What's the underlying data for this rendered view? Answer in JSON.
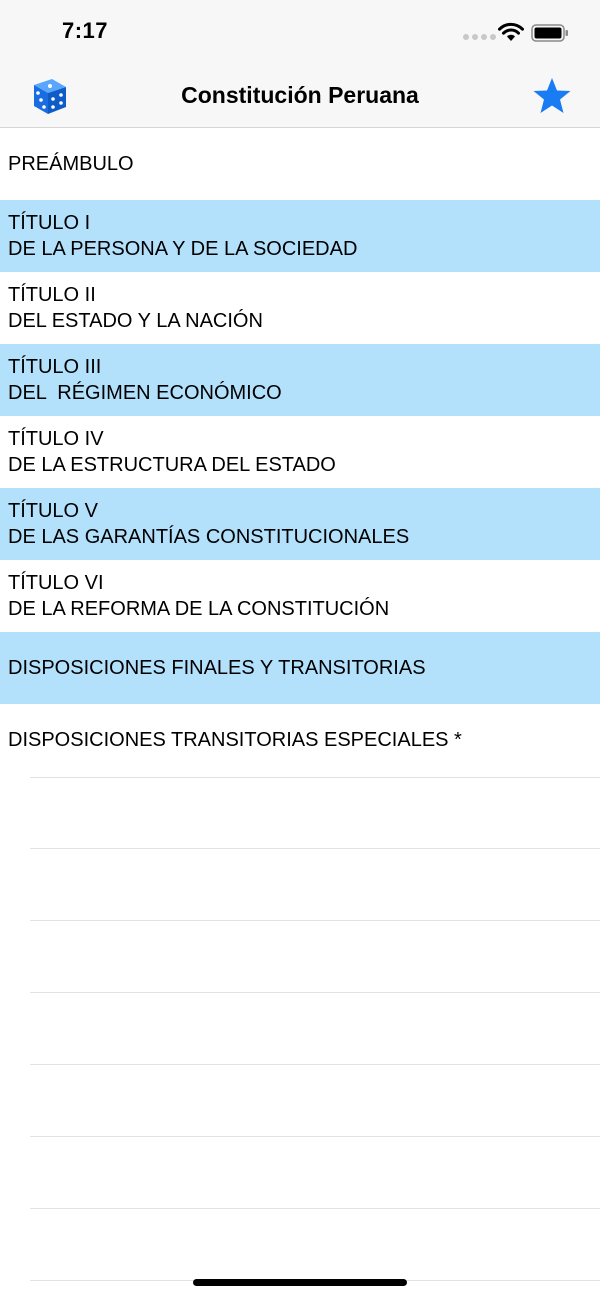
{
  "status_bar": {
    "time": "7:17"
  },
  "nav": {
    "title": "Constitución Peruana",
    "left_icon": "dice-icon",
    "right_icon": "star-icon",
    "accent": "#1a7cf2"
  },
  "highlight_color": "#b3e0fb",
  "items": [
    {
      "lines": [
        "PREÁMBULO"
      ],
      "highlighted": false
    },
    {
      "lines": [
        "TÍTULO I",
        "DE LA PERSONA Y DE LA SOCIEDAD"
      ],
      "highlighted": true
    },
    {
      "lines": [
        "TÍTULO II",
        "DEL ESTADO Y LA NACIÓN"
      ],
      "highlighted": false
    },
    {
      "lines": [
        "TÍTULO III",
        "DEL  RÉGIMEN ECONÓMICO"
      ],
      "highlighted": true
    },
    {
      "lines": [
        "TÍTULO IV",
        "DE LA ESTRUCTURA DEL ESTADO"
      ],
      "highlighted": false
    },
    {
      "lines": [
        "TÍTULO V",
        "DE LAS GARANTÍAS CONSTITUCIONALES"
      ],
      "highlighted": true
    },
    {
      "lines": [
        "TÍTULO VI",
        "DE LA REFORMA DE LA CONSTITUCIÓN"
      ],
      "highlighted": false
    },
    {
      "lines": [
        "DISPOSICIONES FINALES Y TRANSITORIAS"
      ],
      "highlighted": true
    },
    {
      "lines": [
        "DISPOSICIONES TRANSITORIAS ESPECIALES *"
      ],
      "highlighted": false
    }
  ]
}
